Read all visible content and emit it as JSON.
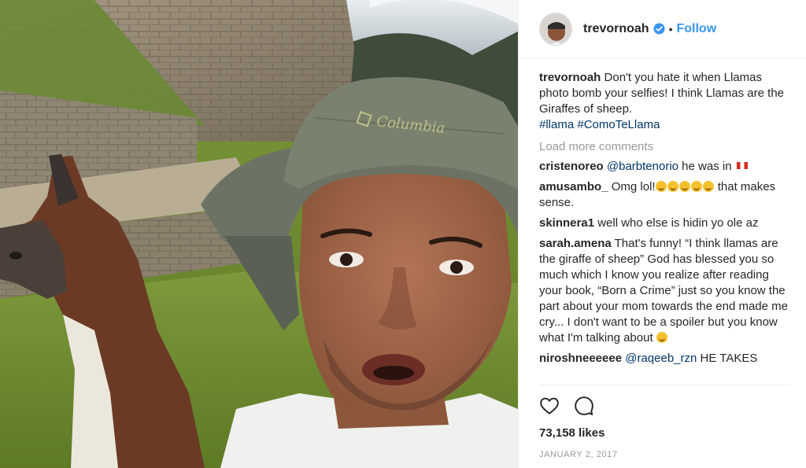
{
  "header": {
    "username": "trevornoah",
    "dot": "•",
    "follow_label": "Follow"
  },
  "caption": {
    "username": "trevornoah",
    "text": "Don't you hate it when Llamas photo bomb your selfies! I think Llamas are the Giraffes of sheep.",
    "hashtags": [
      "#llama",
      "#ComoTeLlama"
    ]
  },
  "load_more_label": "Load more comments",
  "comments": [
    {
      "user": "cristenoreo",
      "mention": "@barbtenorio",
      "text": "he was in"
    },
    {
      "user": "amusambo_",
      "text_before": "Omg lol!",
      "text_after": "that makes sense."
    },
    {
      "user": "skinnera1",
      "text": "well who else is hidin yo ole az"
    },
    {
      "user": "sarah.amena",
      "text": "That's funny! “I think llamas are the giraffe of sheep” God has blessed you so much which I know you realize after reading your book, “Born a Crime” just so you know the part about your mom towards the end made me cry... I don't want to be a spoiler but you know what I'm talking about"
    },
    {
      "user": "niroshneeeeee",
      "mention": "@raqeeb_rzn",
      "text": "HE TAKES"
    }
  ],
  "likes_label": "73,158 likes",
  "date_label": "JANUARY 2, 2017",
  "photo": {
    "hat_text": "Columbia"
  },
  "colors": {
    "link": "#3897f0",
    "mention": "#003569",
    "muted": "#999999",
    "text": "#262626"
  },
  "icons": {
    "verified": "verified-badge-icon",
    "like": "heart-icon",
    "comment": "comment-bubble-icon"
  }
}
